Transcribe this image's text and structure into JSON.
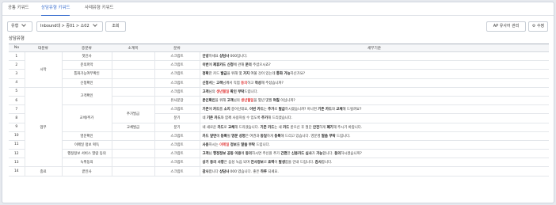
{
  "tabs": [
    {
      "label": "공통 키워드"
    },
    {
      "label": "상담유형 키워드"
    },
    {
      "label": "사례유형 키워드"
    }
  ],
  "filter": {
    "type_label": "유형",
    "category_value": "Inbound대 > 중01 > 소02",
    "search_label": "조회"
  },
  "actions": {
    "ap_label": "AP 유사어 관리",
    "edit_label": "수정"
  },
  "section_title": "상담유형",
  "table": {
    "headers": [
      "No",
      "대분류",
      "중분류",
      "소계목",
      "분류",
      "세부기준"
    ],
    "groups": {
      "g1": "시작",
      "g2": "업무",
      "g3": "종료"
    },
    "mids": {
      "m1": "고객확인",
      "m2": "교체/추가",
      "m3": "영문확인",
      "m4": "행정정보 서비스 열람 동의"
    },
    "subs": {
      "s1": "추가발급",
      "s2": "교체발급"
    },
    "rows": [
      {
        "no": "1",
        "mid": "첫인사",
        "cls": "스크립트",
        "segs": [
          {
            "t": "안녕",
            "s": "hl"
          },
          {
            "t": "하세요 "
          },
          {
            "t": "상담사",
            "s": "hl"
          },
          {
            "t": " 000입니다."
          }
        ]
      },
      {
        "no": "2",
        "mid": "문의파악",
        "cls": "스크립트",
        "segs": [
          {
            "t": "이번",
            "s": "hl"
          },
          {
            "t": "에 "
          },
          {
            "t": "제휴카드 신청",
            "s": "hl"
          },
          {
            "t": "에 관해 "
          },
          {
            "t": "문의",
            "s": "hl"
          },
          {
            "t": " 주셨으시죠?"
          }
        ]
      },
      {
        "no": "3",
        "mid": "통화가능여부확인",
        "cls": "스크립트",
        "segs": [
          {
            "t": "정확",
            "s": "hl"
          },
          {
            "t": "한 카드 "
          },
          {
            "t": "발급",
            "s": "hl"
          },
          {
            "t": "을 위해 몇 "
          },
          {
            "t": "가지",
            "s": "hl"
          },
          {
            "t": " 여쭐 것이 있는데 "
          },
          {
            "t": "통화 가능",
            "s": "hl"
          },
          {
            "t": "하신가요?"
          }
        ]
      },
      {
        "no": "4",
        "mid": "신청확인",
        "cls": "스크립트",
        "segs": [
          {
            "t": "신청서",
            "s": "hl"
          },
          {
            "t": "는 "
          },
          {
            "t": "고객",
            "s": "hl"
          },
          {
            "t": "님께서 직접 "
          },
          {
            "t": "동의",
            "s": "red"
          },
          {
            "t": "하고 "
          },
          {
            "t": "작성",
            "s": "hl"
          },
          {
            "t": "해 주셨습니까?"
          }
        ]
      },
      {
        "no": "5",
        "cls": "스크립트",
        "segs": [
          {
            "t": "고객",
            "s": "hl"
          },
          {
            "t": "님의 "
          },
          {
            "t": "생년월일",
            "s": "red"
          },
          {
            "t": " "
          },
          {
            "t": "확인 부탁",
            "s": "hl"
          },
          {
            "t": "드립니다."
          }
        ]
      },
      {
        "no": "6",
        "cls": "유사문장",
        "segs": [
          {
            "t": "본인확인",
            "s": "hl"
          },
          {
            "t": "을 위해 "
          },
          {
            "t": "고객",
            "s": "hl"
          },
          {
            "t": "님의 "
          },
          {
            "t": "생년월일",
            "s": "red"
          },
          {
            "t": "을 몇년 몇월 "
          },
          {
            "t": "며칠",
            "s": "hl"
          },
          {
            "t": " 이십니까?"
          }
        ]
      },
      {
        "no": "7",
        "cls": "스크립트",
        "segs": [
          {
            "t": "기존",
            "s": "hl"
          },
          {
            "t": "에 "
          },
          {
            "t": "카드",
            "s": "hl"
          },
          {
            "t": "를 "
          },
          {
            "t": "소지",
            "s": "hl"
          },
          {
            "t": " 중이신데요, "
          },
          {
            "t": "이번 카드",
            "s": "hl"
          },
          {
            "t": "는 "
          },
          {
            "t": "추가",
            "s": "hl"
          },
          {
            "t": "로 "
          },
          {
            "t": "발급",
            "s": "hl"
          },
          {
            "t": "하시겠습니까? 아니면 "
          },
          {
            "t": "기존 카드",
            "s": "hl"
          },
          {
            "t": "와 "
          },
          {
            "t": "교체",
            "s": "hl"
          },
          {
            "t": "해 드릴까요?"
          }
        ]
      },
      {
        "no": "8",
        "cls": "분기",
        "segs": [
          {
            "t": "네 "
          },
          {
            "t": "기존 카드",
            "s": "hl"
          },
          {
            "t": "와 함께 사용하실 수 있도록 "
          },
          {
            "t": "추가",
            "s": "hl"
          },
          {
            "t": "해 드리겠습니다."
          }
        ]
      },
      {
        "no": "9",
        "cls": "분기",
        "segs": [
          {
            "t": "네 새로운 "
          },
          {
            "t": "카드",
            "s": "hl"
          },
          {
            "t": "로 "
          },
          {
            "t": "교체",
            "s": "hl"
          },
          {
            "t": "해 드리겠습니다. "
          },
          {
            "t": "기존 카드",
            "s": "hl"
          },
          {
            "t": "는 새 "
          },
          {
            "t": "카드",
            "s": "hl"
          },
          {
            "t": " 받으신 후 절단 "
          },
          {
            "t": "안전",
            "s": "hl"
          },
          {
            "t": "하게 "
          },
          {
            "t": "폐기",
            "s": "hl"
          },
          {
            "t": "해 주시기 바랍니다."
          }
        ]
      },
      {
        "no": "10",
        "cls": "스크립트",
        "segs": [
          {
            "t": "카드 앞면",
            "s": "hl"
          },
          {
            "t": "에 "
          },
          {
            "t": "등록",
            "s": "hl"
          },
          {
            "t": "될 "
          },
          {
            "t": "영문 성명",
            "s": "hl"
          },
          {
            "t": "은 여권과 "
          },
          {
            "t": "동일",
            "s": "hl"
          },
          {
            "t": "하게 "
          },
          {
            "t": "등록",
            "s": "hl"
          },
          {
            "t": "해 드리고 있습니다. 영문명 "
          },
          {
            "t": "말씀 부탁",
            "s": "hl"
          },
          {
            "t": " 드립니다."
          }
        ]
      },
      {
        "no": "11",
        "mid": "이메일 정보 획득",
        "cls": "스크립트",
        "segs": [
          {
            "t": "사용",
            "s": "hl"
          },
          {
            "t": "하시는 "
          },
          {
            "t": "이메일",
            "s": "red"
          },
          {
            "t": " 정보",
            "s": "hl"
          },
          {
            "t": "를 "
          },
          {
            "t": "말씀 부탁",
            "s": "hl"
          },
          {
            "t": " 드립니다."
          }
        ]
      },
      {
        "no": "12",
        "cls": "스크립트",
        "segs": [
          {
            "t": "고객",
            "s": "hl"
          },
          {
            "t": "님 "
          },
          {
            "t": "행정정보 공동 이용",
            "s": "hl"
          },
          {
            "t": "에 "
          },
          {
            "t": "동의",
            "s": "hl"
          },
          {
            "t": "하시면 주신원 추가 "
          },
          {
            "t": "간편",
            "s": "hl"
          },
          {
            "t": "한 "
          },
          {
            "t": "신용카드 심사",
            "s": "hl"
          },
          {
            "t": "가 "
          },
          {
            "t": "가능",
            "s": "hl"
          },
          {
            "t": "합니다. "
          },
          {
            "t": "동의",
            "s": "hl"
          },
          {
            "t": "하시겠습니까?"
          }
        ]
      },
      {
        "no": "13",
        "mid": "녹취동의",
        "cls": "스크립트",
        "segs": [
          {
            "t": "상기 동의 사항",
            "s": "hl"
          },
          {
            "t": "은 음성 녹음 되며 "
          },
          {
            "t": "전사정보",
            "s": "hl"
          },
          {
            "t": "로 "
          },
          {
            "t": "효력",
            "s": "hl"
          },
          {
            "t": "이 "
          },
          {
            "t": "발생",
            "s": "hl"
          },
          {
            "t": "함을 안내 드립니다. "
          },
          {
            "t": "감사",
            "s": "hl"
          },
          {
            "t": "합니다."
          }
        ]
      },
      {
        "no": "14",
        "mid": "끝인사",
        "cls": "스크립트",
        "segs": [
          {
            "t": "감사",
            "s": "hl"
          },
          {
            "t": "합니다 "
          },
          {
            "t": "상담사",
            "s": "hl"
          },
          {
            "t": " 000 였습니다. 좋은 "
          },
          {
            "t": "하루",
            "s": "hl"
          },
          {
            "t": " 되세요."
          }
        ]
      }
    ]
  }
}
